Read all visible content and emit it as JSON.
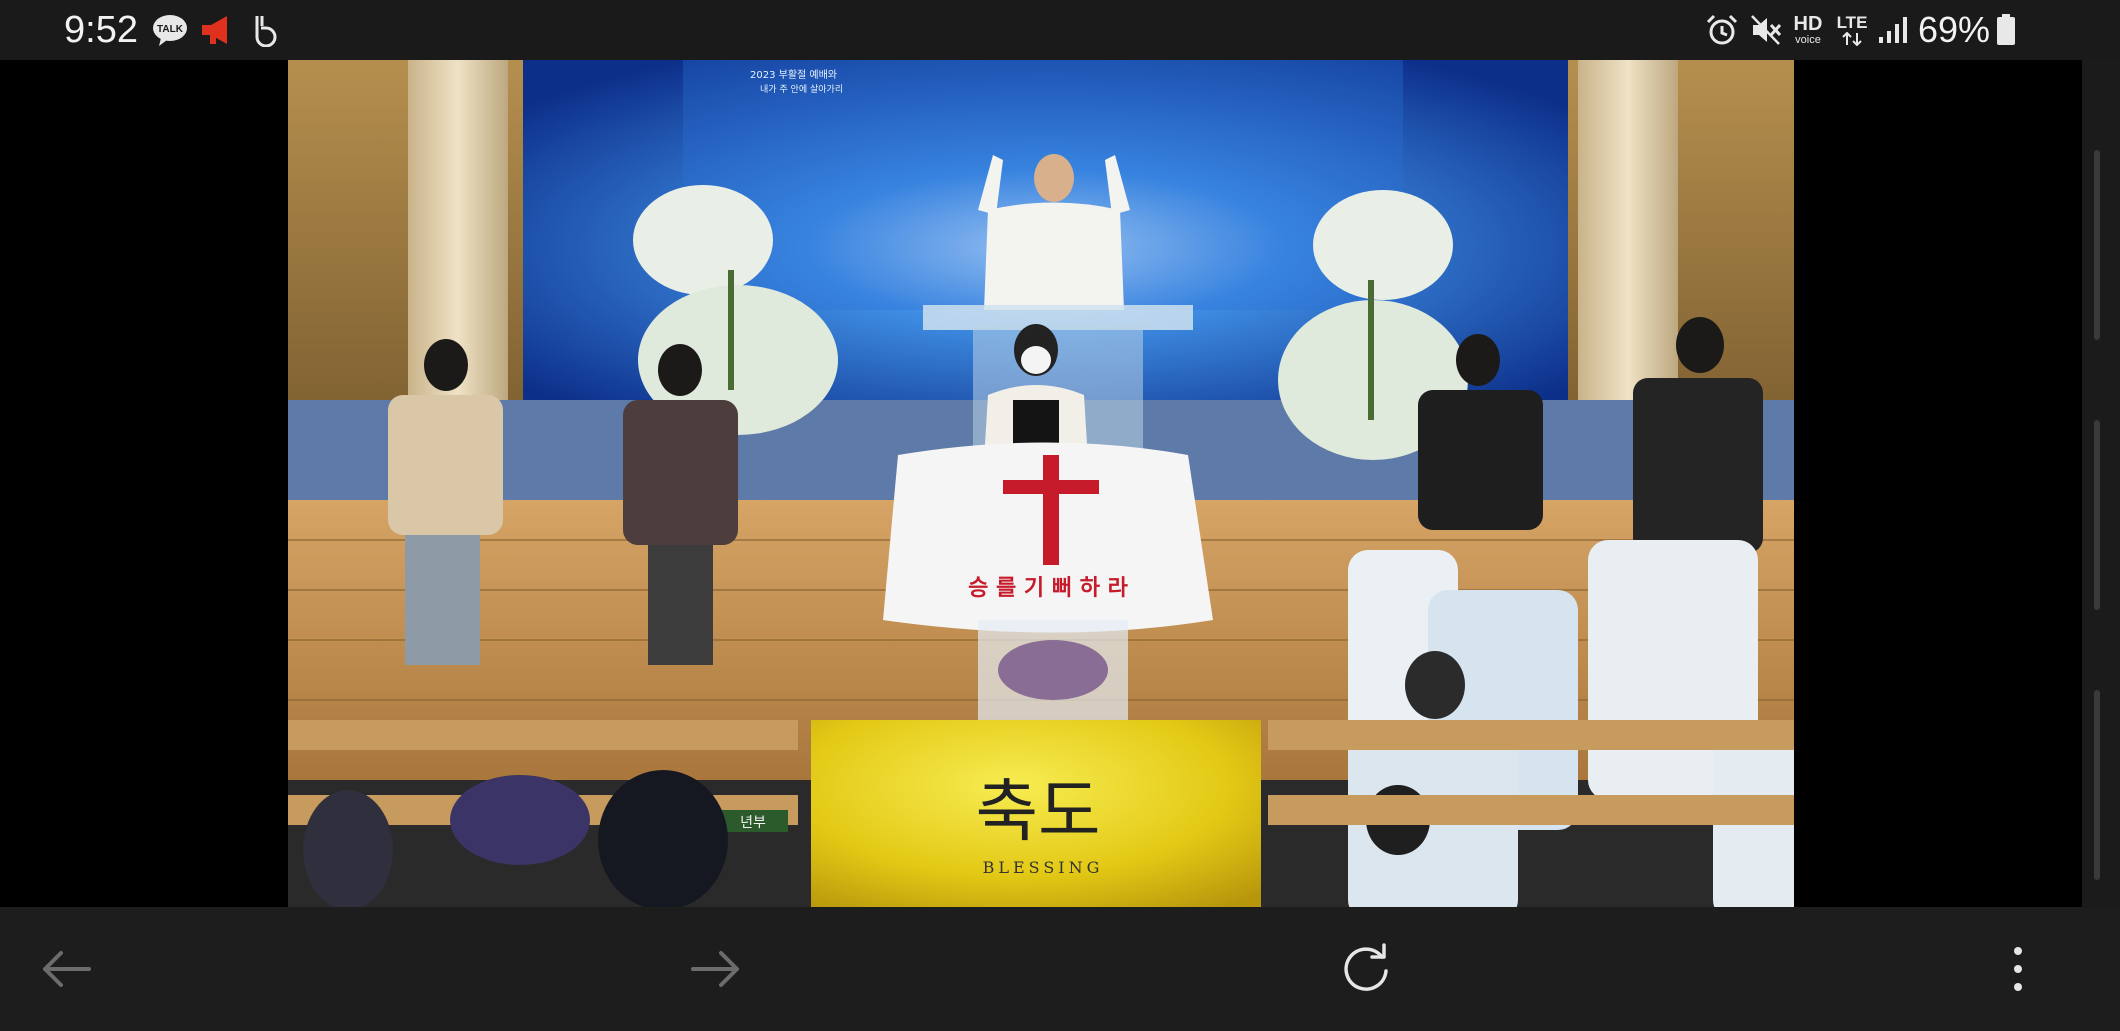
{
  "status_bar": {
    "time": "9:52",
    "notification_icons": [
      "kakaotalk-talk-icon",
      "megaphone-icon",
      "b-app-icon"
    ],
    "talk_badge_text": "TALK",
    "system_icons": [
      "alarm-icon",
      "mute-icon",
      "hd-voice-icon",
      "lte-icon",
      "signal-icon",
      "battery-icon"
    ],
    "hd_label": "HD",
    "voice_label": "voice",
    "lte_label": "LTE",
    "battery_percent": "69%"
  },
  "video": {
    "banner_line1": "2023 부활절 예배와",
    "banner_line2": "내가 주 안에 살아가리",
    "podium_cloth_text": "승 를 기 뻐 하 라",
    "slide_title": "축도",
    "slide_subtitle": "BLESSING",
    "pew_sign_text": "년부"
  },
  "browser_toolbar": {
    "back_icon": "arrow-left-icon",
    "forward_icon": "arrow-right-icon",
    "reload_icon": "reload-icon",
    "menu_icon": "kebab-menu-icon"
  },
  "colors": {
    "status_bg": "#1a1a1a",
    "toolbar_bg": "#1d1d1d",
    "megaphone_red": "#e0301e",
    "slide_yellow": "#e9d21a"
  }
}
